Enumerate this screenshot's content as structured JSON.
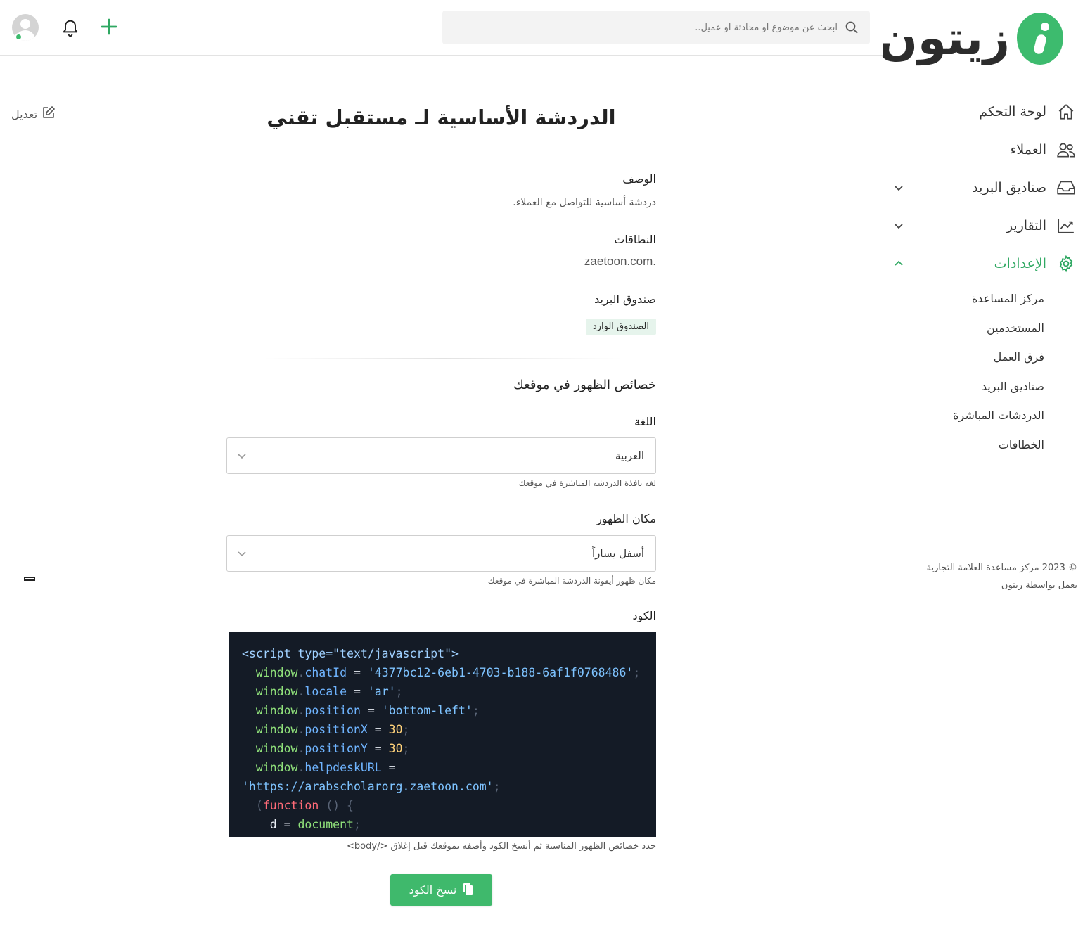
{
  "brand": {
    "name": "زيتون",
    "accent": "#3dbb6e"
  },
  "search": {
    "placeholder": "ابحث عن موضوع أو محادثة أو عميل.."
  },
  "sidebar": {
    "items": [
      {
        "label": "لوحة التحكم",
        "icon": "home-icon"
      },
      {
        "label": "العملاء",
        "icon": "users-icon"
      },
      {
        "label": "صناديق البريد",
        "icon": "inbox-icon"
      },
      {
        "label": "التقارير",
        "icon": "chart-icon"
      },
      {
        "label": "الإعدادات",
        "icon": "gear-icon"
      }
    ],
    "settings_sub": [
      "مركز المساعدة",
      "المستخدمين",
      "فرق العمل",
      "صناديق البريد",
      "الدردشات المباشرة",
      "الخطافات"
    ],
    "footer_line1": "© 2023 مركز مساعدة العلامة التجارية",
    "footer_line2": "يعمل بواسطة زيتون"
  },
  "main": {
    "edit_label": "تعديل",
    "title": "الدردشة الأساسية لـ مستقبل تقني",
    "description_label": "الوصف",
    "description_value": "دردشة أساسية للتواصل مع العملاء.",
    "domains_label": "النطاقات",
    "domains_value": ".zaetoon.com",
    "mailbox_label": "صندوق البريد",
    "mailbox_tag": "الصندوق الوارد",
    "appearance_title": "خصائص الظهور في موقعك",
    "language_label": "اللغة",
    "language_value": "العربية",
    "language_hint": "لغة نافذة الدردشة المباشرة في موقعك",
    "position_label": "مكان الظهور",
    "position_value": "أسفل يساراً",
    "position_hint": "مكان ظهور أيقونة الدردشة المباشرة في موقعك",
    "code_label": "الكود",
    "code": {
      "script_open": "<script type=\"text/javascript\">",
      "chat_id": "'4377bc12-6eb1-4703-b188-6af1f0768486'",
      "locale": "'ar'",
      "position": "'bottom-left'",
      "position_x": "30",
      "position_y": "30",
      "helpdesk_url": "'https://arabscholarorg.zaetoon.com'"
    },
    "code_hint": "حدد خصائص الظهور المناسبة ثم أنسخ الكود وأضفه بموقعك قبل إغلاق </body>",
    "copy_button": "نسخ الكود"
  }
}
